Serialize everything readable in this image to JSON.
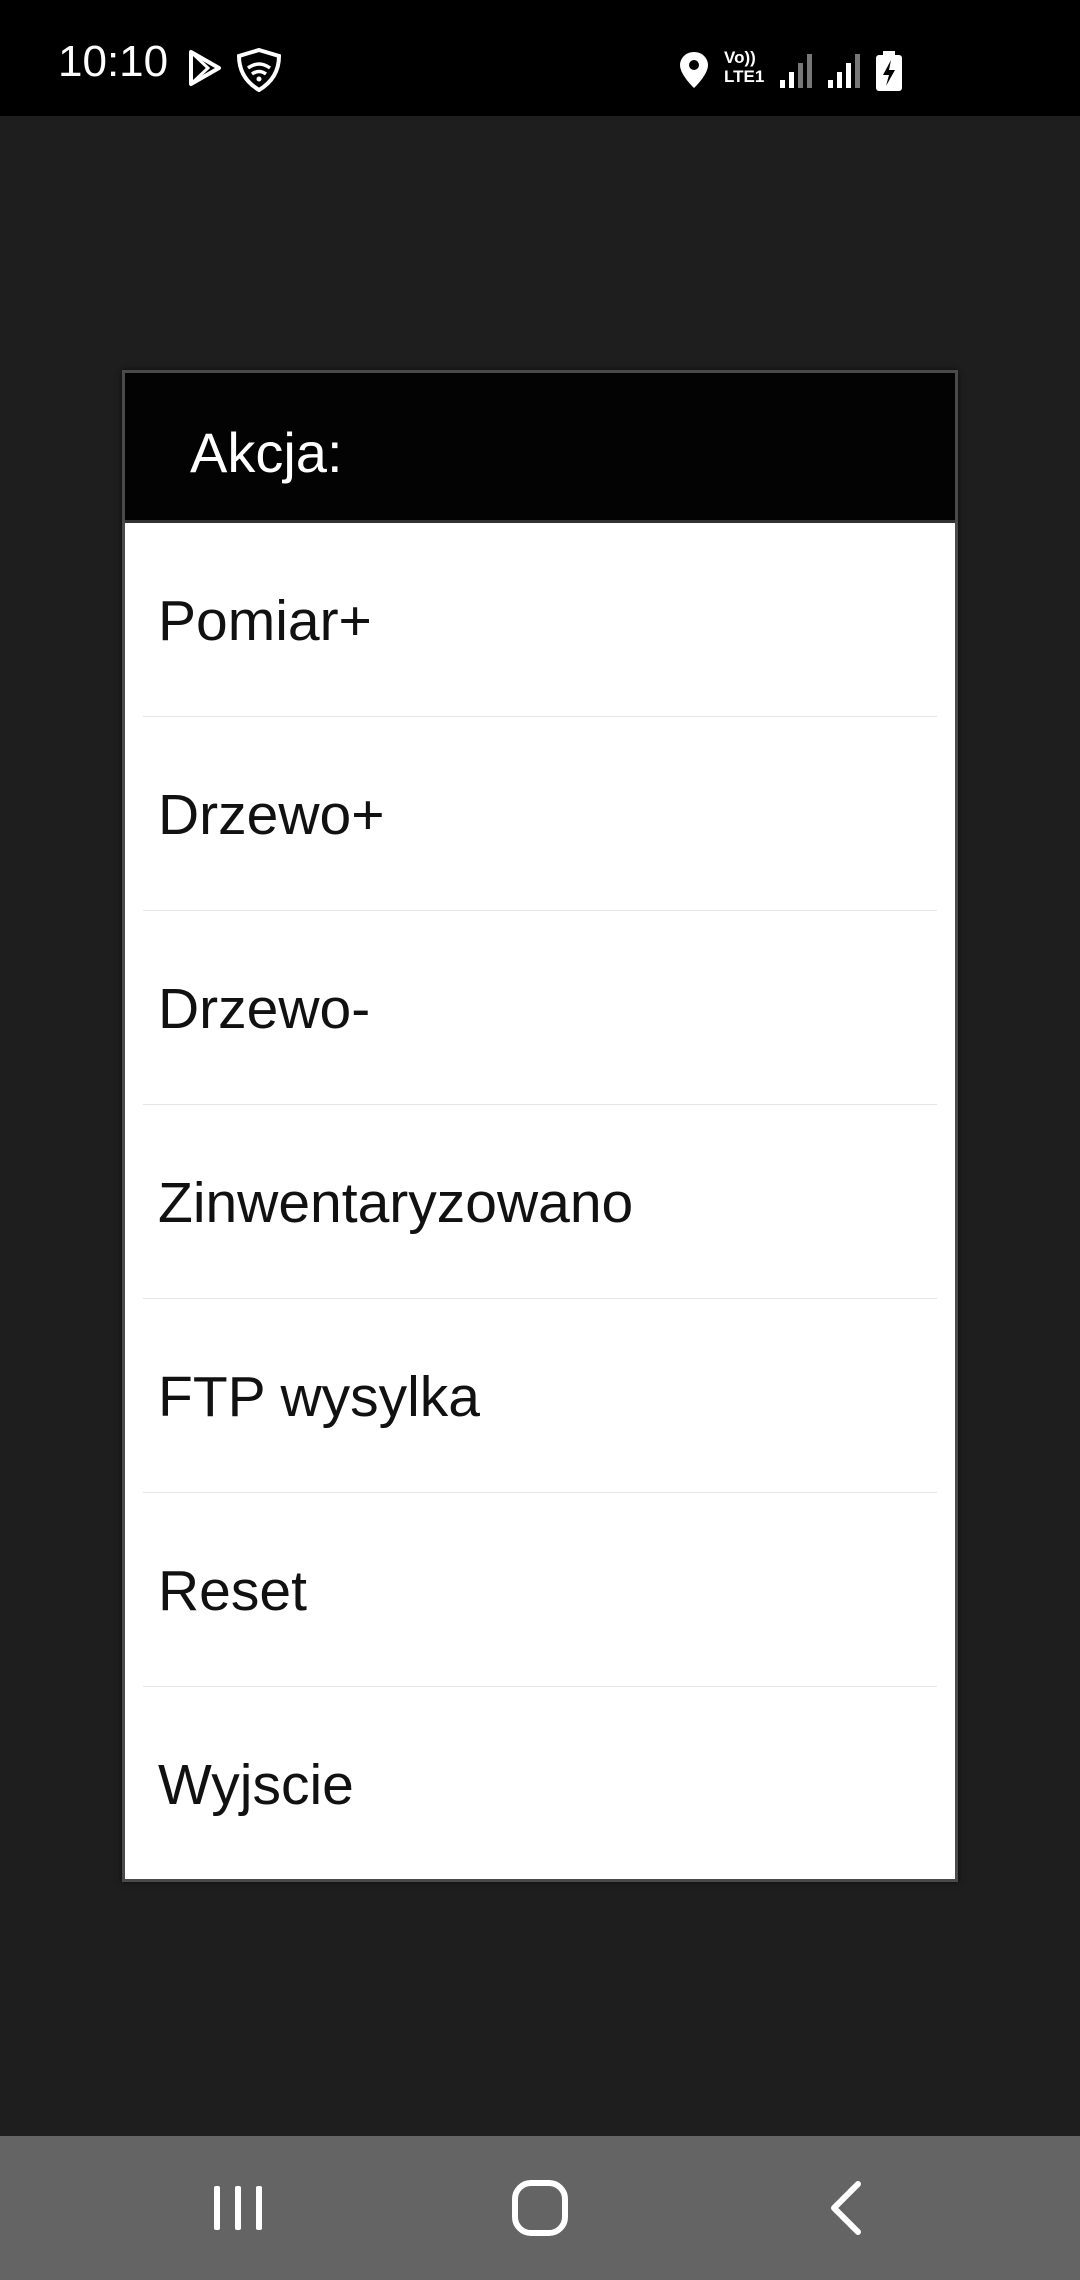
{
  "status_bar": {
    "time": "10:10",
    "volte_top": "Vo))",
    "volte_bottom": "LTE1",
    "icons": [
      "play-store-icon",
      "shield-icon",
      "location-icon",
      "volte-icon",
      "signal-icon",
      "signal-icon",
      "battery-charging-icon"
    ]
  },
  "dialog": {
    "title": "Akcja:",
    "items": [
      {
        "label": "Pomiar+"
      },
      {
        "label": "Drzewo+"
      },
      {
        "label": "Drzewo-"
      },
      {
        "label": "Zinwentaryzowano"
      },
      {
        "label": "FTP wysylka"
      },
      {
        "label": "Reset"
      },
      {
        "label": "Wyjscie"
      }
    ]
  },
  "nav_bar": {
    "buttons": [
      "recents",
      "home",
      "back"
    ]
  },
  "colors": {
    "background": "#1e1e1e",
    "status_bar": "#000000",
    "dialog_header": "#030303",
    "dialog_body": "#ffffff",
    "nav_bar": "#646464"
  }
}
